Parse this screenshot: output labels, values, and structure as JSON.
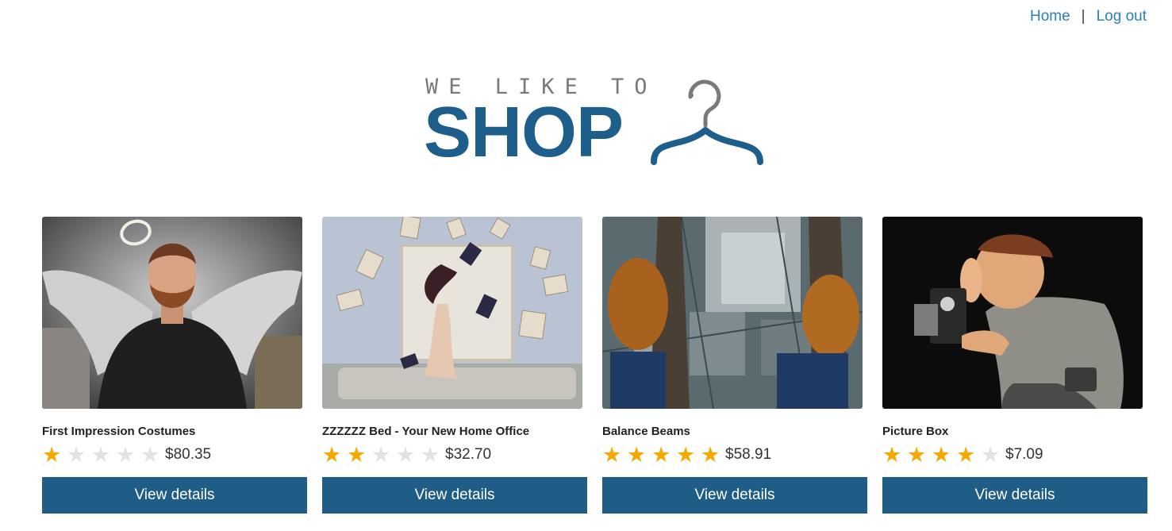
{
  "nav": {
    "home": "Home",
    "separator": "|",
    "logout": "Log out"
  },
  "logo": {
    "tagline": "WE LIKE TO",
    "word": "SHOP",
    "icon": "hanger-icon"
  },
  "colors": {
    "link": "#2a80b9",
    "brand": "#1d5f8a",
    "button": "#1f5d86",
    "star_on": "#f5a800",
    "star_off": "#e2e2e2"
  },
  "products": [
    {
      "title": "First Impression Costumes",
      "rating": 1,
      "max_rating": 5,
      "price": "$80.35",
      "button": "View details",
      "image": "bearded-man-with-angel-wings-halo"
    },
    {
      "title": "ZZZZZZ Bed - Your New Home Office",
      "rating": 2,
      "max_rating": 5,
      "price": "$32.70",
      "button": "View details",
      "image": "woman-on-bed-with-flying-books"
    },
    {
      "title": "Balance Beams",
      "rating": 5,
      "max_rating": 5,
      "price": "$58.91",
      "button": "View details",
      "image": "feet-on-beam-over-city"
    },
    {
      "title": "Picture Box",
      "rating": 4,
      "max_rating": 5,
      "price": "$7.09",
      "button": "View details",
      "image": "caricature-man-with-old-camera"
    }
  ]
}
